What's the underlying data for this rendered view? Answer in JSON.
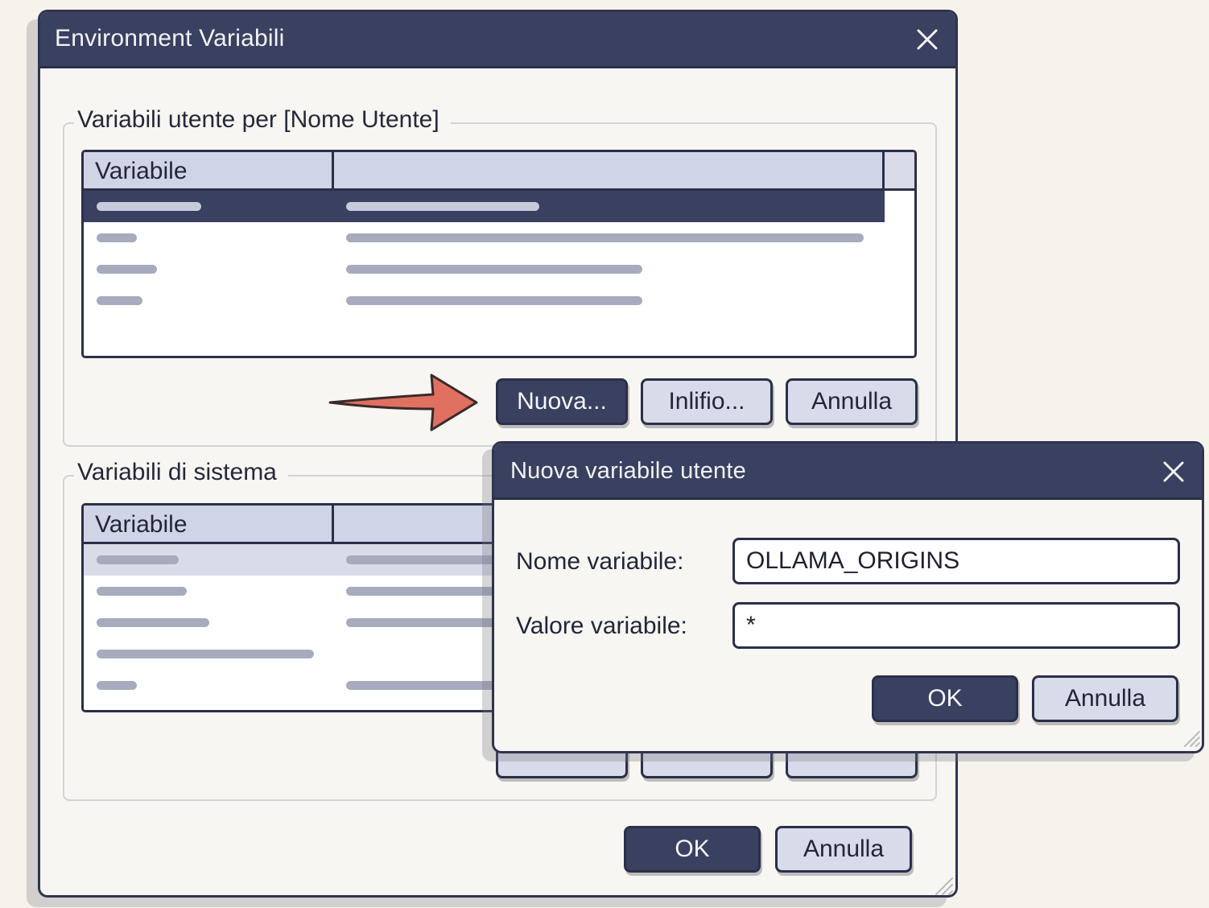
{
  "main_window": {
    "title": "Environment Variabili",
    "user_group": {
      "label": "Variabili utente per [Nome Utente]",
      "column_variable": "Variabile",
      "buttons": {
        "new": "Nuova...",
        "edit": "Inlifio...",
        "cancel": "Annulla"
      }
    },
    "system_group": {
      "label": "Variabili di sistema",
      "column_variable": "Variabile"
    },
    "footer": {
      "ok": "OK",
      "cancel": "Annulla"
    }
  },
  "dialog": {
    "title": "Nuova variabile utente",
    "name_label": "Nome variabile:",
    "name_value": "OLLAMA_ORIGINS",
    "value_label": "Valore variabile:",
    "value_value": "*",
    "ok": "OK",
    "cancel": "Annulla"
  },
  "colors": {
    "titlebar": "#3a4060",
    "primary_button": "#3a4060",
    "secondary_button": "#d7dbea",
    "arrow": "#e07060"
  }
}
